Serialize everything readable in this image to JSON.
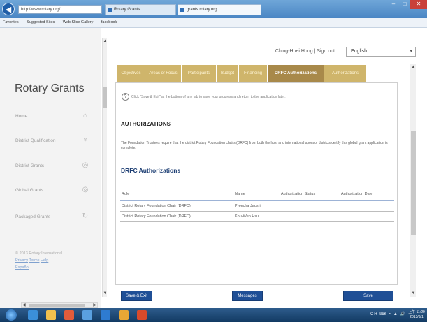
{
  "browser": {
    "address": "http://www.rotary.org/...",
    "tabs": [
      {
        "label": "Rotary Grants"
      },
      {
        "label": "grants.rotary.org"
      }
    ],
    "favorites": [
      "Favorites",
      "Suggested Sites",
      "Web Slice Gallery",
      "facebook"
    ]
  },
  "sidebar": {
    "brand": "Rotary Grants",
    "items": [
      {
        "label": "Home",
        "icon": "home-icon",
        "glyph": "⌂"
      },
      {
        "label": "District Qualification",
        "icon": "trophy-icon",
        "glyph": "♆"
      },
      {
        "label": "District Grants",
        "icon": "globe-icon",
        "glyph": "◎"
      },
      {
        "label": "Global Grants",
        "icon": "globe-icon",
        "glyph": "◎"
      },
      {
        "label": "Packaged Grants",
        "icon": "cycle-icon",
        "glyph": "↻"
      }
    ],
    "copyright": "© 2013 Rotary International",
    "footer_links": [
      "Privacy",
      "Terms",
      "Help"
    ],
    "footer_extra": "Español"
  },
  "header": {
    "user": "Ching-Huei Hong | Sign out",
    "language": "English"
  },
  "tabs": [
    {
      "label": "Objectives",
      "active": false
    },
    {
      "label": "Areas of Focus",
      "active": false
    },
    {
      "label": "Participants",
      "active": false
    },
    {
      "label": "Budget",
      "active": false
    },
    {
      "label": "Financing",
      "active": false
    },
    {
      "label": "DRFC Authorizations",
      "active": true
    },
    {
      "label": "Authorizations",
      "active": false
    }
  ],
  "main": {
    "hint": "Click \"Save & Exit\" at the bottom of any tab to save your progress and return to the application later.",
    "section_title": "AUTHORIZATIONS",
    "paragraph": "The Foundation Trustees require that the district Rotary Foundation chairs (DRFC) from both the host and international sponsor districts certify this global grant application is complete.",
    "sub_title": "DRFC Authorizations",
    "table": {
      "headers": [
        "Role",
        "Name",
        "Authorization Status",
        "Authorization Date"
      ],
      "rows": [
        [
          "District Rotary Foundation Chair (DRFC)",
          "Preecha Jadsri",
          "",
          ""
        ],
        [
          "District Rotary Foundation Chair (DRFC)",
          "Kou-Wen Hsu",
          "",
          ""
        ]
      ]
    }
  },
  "buttons": {
    "save_exit": "Save & Exit",
    "messages": "Messages",
    "save": "Save"
  },
  "taskbar": {
    "tray": "CH ⌨ ◔ ▲ 🔊",
    "time": "上午 11:29",
    "date": "2013/3/1"
  },
  "colors": {
    "tab_gold": "#cfb56b",
    "tab_active": "#a8894a",
    "button_blue": "#1f4f96",
    "heading_blue": "#1e3f74"
  }
}
